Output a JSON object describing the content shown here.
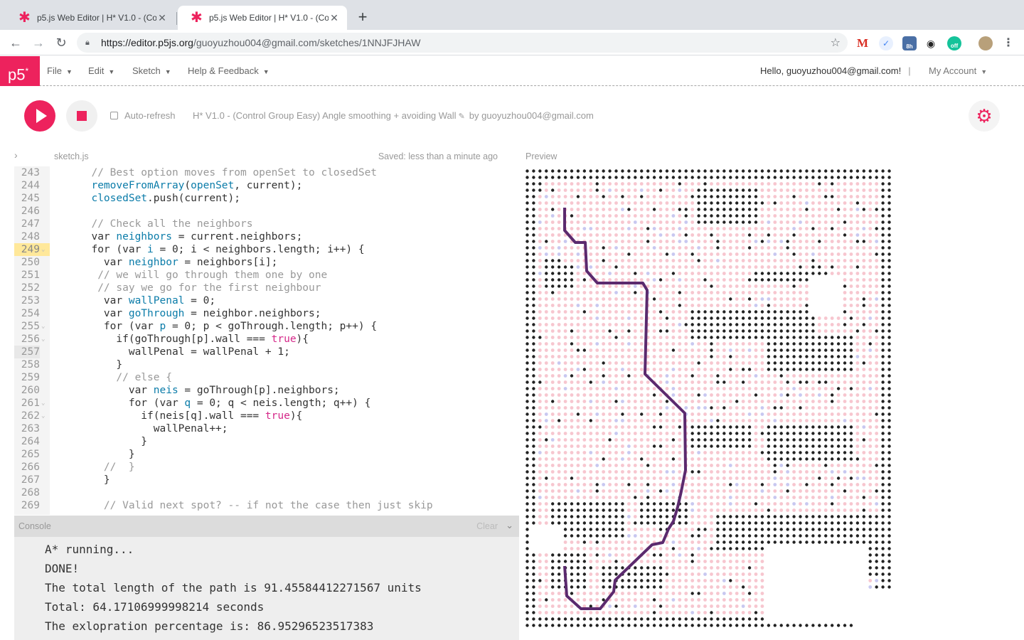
{
  "browser": {
    "tabs": [
      {
        "title": "p5.js Web Editor | H* V1.0 - (Co",
        "active": false
      },
      {
        "title": "p5.js Web Editor | H* V1.0 - (Co",
        "active": true
      }
    ],
    "url_host": "https://editor.p5js.org",
    "url_path": "/guoyuzhou004@gmail.com/sketches/1NNJFJHAW",
    "extensions": [
      {
        "name": "gmail-extension-icon",
        "label": "M"
      },
      {
        "name": "vpn-extension-icon",
        "label": "✓"
      },
      {
        "name": "calendar-extension-icon",
        "label": "8h"
      },
      {
        "name": "incognito-extension-icon",
        "label": "◉"
      },
      {
        "name": "grammarly-extension-icon",
        "label": "off"
      }
    ]
  },
  "p5nav": {
    "logo": "p5",
    "logo_sup": "*",
    "menus": [
      "File",
      "Edit",
      "Sketch",
      "Help & Feedback"
    ],
    "greeting": "Hello, guoyuzhou004@gmail.com!",
    "account": "My Account"
  },
  "toolbar": {
    "auto_refresh": "Auto-refresh",
    "sketch_name": "H* V1.0 - (Control Group Easy) Angle smoothing + avoiding Wall",
    "by": "by guoyuzhou004@gmail.com"
  },
  "editor": {
    "file": "sketch.js",
    "saved": "Saved: less than a minute ago",
    "lines": [
      {
        "n": "243",
        "text": "  // Best option moves from openSet to closedSet"
      },
      {
        "n": "244",
        "text": "  removeFromArray(openSet, current);"
      },
      {
        "n": "245",
        "text": "  closedSet.push(current);"
      },
      {
        "n": "246",
        "text": ""
      },
      {
        "n": "247",
        "text": "  // Check all the neighbors"
      },
      {
        "n": "248",
        "text": "  var neighbors = current.neighbors;"
      },
      {
        "n": "249",
        "text": "  for (var i = 0; i < neighbors.length; i++) {"
      },
      {
        "n": "250",
        "text": "    var neighbor = neighbors[i];"
      },
      {
        "n": "251",
        "text": "   // we will go through them one by one"
      },
      {
        "n": "252",
        "text": "   // say we go for the first neighbour"
      },
      {
        "n": "253",
        "text": "    var wallPenal = 0;"
      },
      {
        "n": "254",
        "text": "    var goThrough = neighbor.neighbors;"
      },
      {
        "n": "255",
        "text": "    for (var p = 0; p < goThrough.length; p++) {"
      },
      {
        "n": "256",
        "text": "      if(goThrough[p].wall === true){"
      },
      {
        "n": "257",
        "text": "        wallPenal = wallPenal + 1;"
      },
      {
        "n": "258",
        "text": "      }"
      },
      {
        "n": "259",
        "text": "      // else {"
      },
      {
        "n": "260",
        "text": "        var neis = goThrough[p].neighbors;"
      },
      {
        "n": "261",
        "text": "        for (var q = 0; q < neis.length; q++) {"
      },
      {
        "n": "262",
        "text": "          if(neis[q].wall === true){"
      },
      {
        "n": "263",
        "text": "            wallPenal++;"
      },
      {
        "n": "264",
        "text": "          }"
      },
      {
        "n": "265",
        "text": "        }"
      },
      {
        "n": "266",
        "text": "    //  }"
      },
      {
        "n": "267",
        "text": "    }"
      },
      {
        "n": "268",
        "text": ""
      },
      {
        "n": "269",
        "text": "    // Valid next spot? -- if not the case then just skip"
      }
    ]
  },
  "console": {
    "label": "Console",
    "clear": "Clear",
    "lines": [
      "A* running...",
      "DONE!",
      "The total length of the path is 91.45584412271567 units",
      "Total: 64.17106999998214 seconds",
      "The exlopration percentage is: 86.95296523517383"
    ]
  },
  "preview": {
    "label": "Preview",
    "colors": {
      "wall": "#222222",
      "explored": "#f7c6cf",
      "open": "#c8c8f0",
      "path": "#5b2a6e"
    }
  }
}
